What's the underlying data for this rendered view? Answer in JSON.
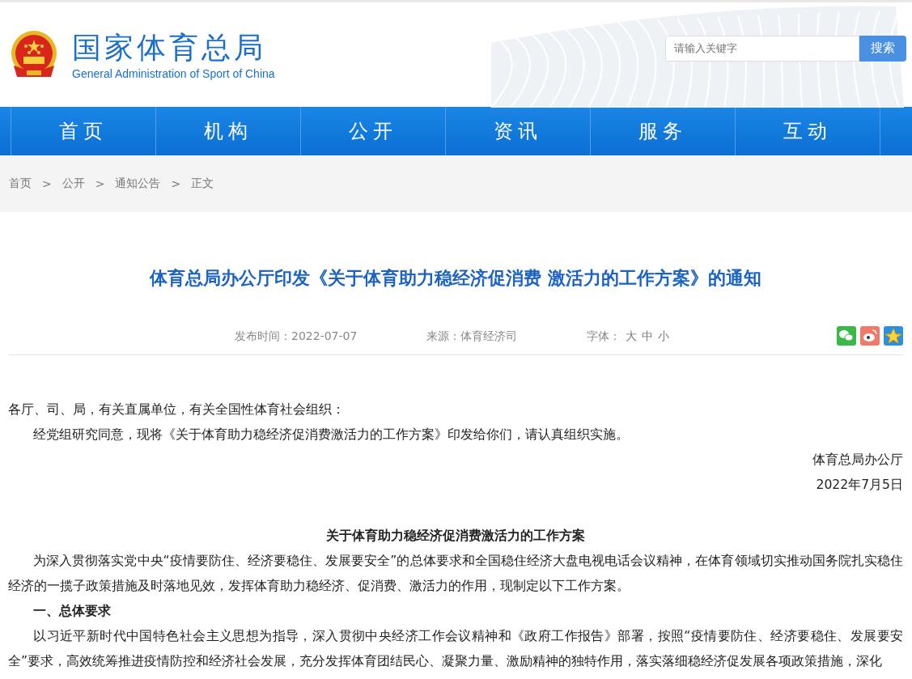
{
  "header": {
    "title": "国家体育总局",
    "subtitle": "General Administration of Sport of China",
    "search": {
      "placeholder": "请输入关键字",
      "button": "搜索"
    }
  },
  "nav": [
    {
      "label": "首页",
      "selected": false
    },
    {
      "label": "机构",
      "selected": false
    },
    {
      "label": "公开",
      "selected": false
    },
    {
      "label": "资讯",
      "selected": false
    },
    {
      "label": "服务",
      "selected": false
    },
    {
      "label": "互动",
      "selected": false
    }
  ],
  "breadcrumb": [
    "首页",
    "公开",
    "通知公告",
    "正文"
  ],
  "breadcrumb_separator": ">",
  "article": {
    "title": "体育总局办公厅印发《关于体育助力稳经济促消费 激活力的工作方案》的通知",
    "meta": {
      "date_label": "发布时间：",
      "date": "2022-07-07",
      "source_label": "来源：",
      "source": "体育经济司",
      "font_label": "字体：",
      "font_sizes": [
        "大",
        "中",
        "小"
      ]
    },
    "share": [
      {
        "kind": "wechat",
        "color": "#3bb84a"
      },
      {
        "kind": "weibo",
        "color": "#f07a6a"
      },
      {
        "kind": "qzone",
        "color": "#2a8fe0"
      }
    ],
    "body": [
      {
        "kind": "plain",
        "text": "各厅、司、局，有关直属单位，有关全国性体育社会组织："
      },
      {
        "kind": "indent",
        "text": "经党组研究同意，现将《关于体育助力稳经济促消费激活力的工作方案》印发给你们，请认真组织实施。"
      },
      {
        "kind": "right",
        "text": "体育总局办公厅"
      },
      {
        "kind": "right",
        "text": "2022年7月5日"
      },
      {
        "kind": "heading",
        "text": "关于体育助力稳经济促消费激活力的工作方案"
      },
      {
        "kind": "indent",
        "text": "为深入贯彻落实党中央“疫情要防住、经济要稳住、发展要安全”的总体要求和全国稳住经济大盘电视电话会议精神，在体育领域切实推动国务院扎实稳住经济的一揽子政策措施及时落地见效，发挥体育助力稳经济、促消费、激活力的作用，现制定以下工作方案。"
      },
      {
        "kind": "section",
        "text": "一、总体要求"
      },
      {
        "kind": "indent",
        "text": "以习近平新时代中国特色社会主义思想为指导，深入贯彻中央经济工作会议精神和《政府工作报告》部署，按照“疫情要防住、经济要稳住、发展要安全”要求，高效统筹推进疫情防控和经济社会发展，充分发挥体育团结民心、凝聚力量、激励精神的独特作用，落实落细稳经济促发展各项政策措施，深化"
      }
    ]
  }
}
